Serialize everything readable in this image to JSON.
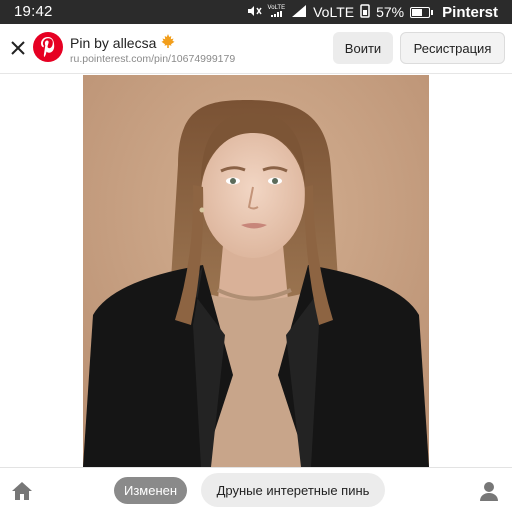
{
  "status_bar": {
    "time": "19:42",
    "volte_small": "VoLTE",
    "volte": "VoLTE",
    "battery": "57%",
    "app_name": "Pinterst"
  },
  "header": {
    "title": "Pin by allecsa",
    "url": "ru.pointerest.com/pin/10674999179",
    "login_label": "Воити",
    "register_label": "Ресистрация"
  },
  "bottom_bar": {
    "edited_label": "Изменен",
    "search_label": "Друные интеретные пинь"
  },
  "colors": {
    "brand": "#e60023",
    "status_bar": "#2b2b2b",
    "photo_background": "#c9a488",
    "jacket": "#151515",
    "sweater": "#c8a58a"
  },
  "icons": [
    "close-icon",
    "pinterest-logo-icon",
    "maple-leaf-icon",
    "mute-icon",
    "signal-icon",
    "battery-icon",
    "home-icon",
    "profile-icon"
  ]
}
